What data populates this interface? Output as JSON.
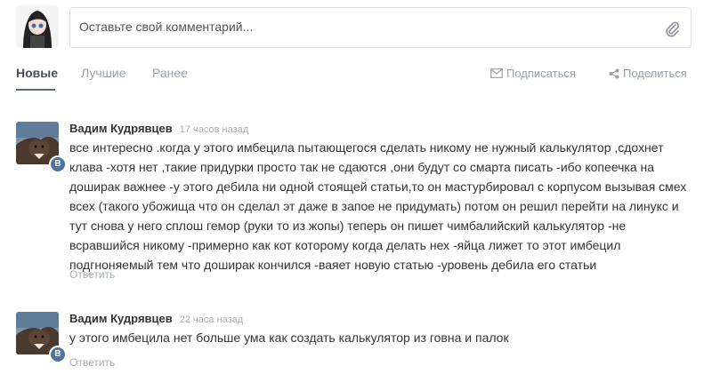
{
  "composer": {
    "placeholder": "Оставьте свой комментарий...",
    "attach_icon": "paperclip-icon"
  },
  "tabs": [
    {
      "label": "Новые",
      "active": true
    },
    {
      "label": "Лучшие",
      "active": false
    },
    {
      "label": "Ранее",
      "active": false
    }
  ],
  "actions": {
    "subscribe": "Подписаться",
    "share": "Поделиться"
  },
  "comments": [
    {
      "author": "Вадим Кудрявцев",
      "time": "17 часов назад",
      "badge": "В",
      "lines": [
        "все интересно .когда у этого имбецила пытающегося сделать никому не нужный калькулятор ,сдохнет",
        "клава -хотя нет ,такие придурки просто так не сдаются ,они будут со смарта писать -ибо копеечка на",
        "доширак важнее -у этого дебила ни одной стоящей статьи,то он мастурбировал с корпусом вызывая смех",
        "всех (такого убожища что он сделал эт даже в запое не придумать) потом он решил перейти на линукс и",
        "тут снова у него сплош гемор (руки то из жопы) теперь он пишет чимбалийский калькулятор -не",
        "всравшийся никому -примерно как кот которому когда делать нех -яйца лижет то этот имбецил",
        "подгноняемый  тем что доширак кончился -ваяет новую статью -уровень дебила его статьи"
      ],
      "reply": "Ответить"
    },
    {
      "author": "Вадим Кудрявцев",
      "time": "22 часа назад",
      "badge": "В",
      "lines": [
        "у этого имбецила нет больше ума как создать калькулятор из говна и палок"
      ],
      "reply": "Ответить"
    }
  ],
  "colors": {
    "accent": "#4c75a3",
    "muted": "#9aa0a6"
  }
}
